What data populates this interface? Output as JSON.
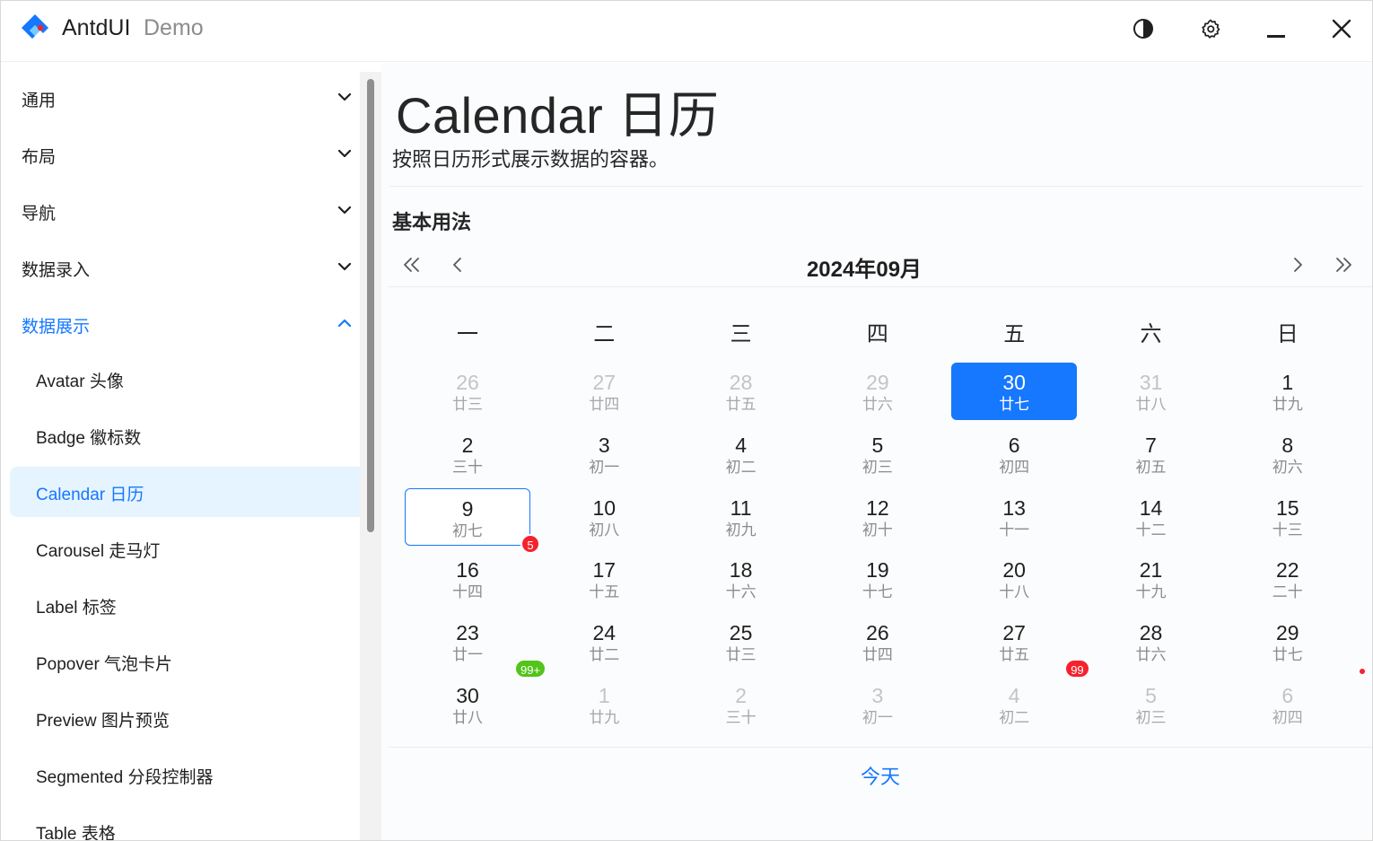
{
  "app": {
    "title": "AntdUI",
    "subtitle": "Demo"
  },
  "titlebar": {
    "icons": [
      "theme-toggle-icon",
      "settings-gear-icon",
      "minimize-icon",
      "close-icon"
    ]
  },
  "sidebar": {
    "groups": [
      {
        "label": "通用",
        "expanded": false
      },
      {
        "label": "布局",
        "expanded": false
      },
      {
        "label": "导航",
        "expanded": false
      },
      {
        "label": "数据录入",
        "expanded": false
      },
      {
        "label": "数据展示",
        "expanded": true
      }
    ],
    "items": [
      {
        "label": "Avatar 头像"
      },
      {
        "label": "Badge 徽标数"
      },
      {
        "label": "Calendar 日历",
        "active": true
      },
      {
        "label": "Carousel 走马灯"
      },
      {
        "label": "Label 标签"
      },
      {
        "label": "Popover 气泡卡片"
      },
      {
        "label": "Preview 图片预览"
      },
      {
        "label": "Segmented 分段控制器"
      },
      {
        "label": "Table 表格"
      }
    ]
  },
  "main": {
    "title": "Calendar 日历",
    "description": "按照日历形式展示数据的容器。",
    "section": "基本用法",
    "calendar": {
      "month_label": "2024年09月",
      "weekdays": [
        "一",
        "二",
        "三",
        "四",
        "五",
        "六",
        "日"
      ],
      "weeks": [
        [
          {
            "d": "26",
            "l": "廿三",
            "other": true
          },
          {
            "d": "27",
            "l": "廿四",
            "other": true
          },
          {
            "d": "28",
            "l": "廿五",
            "other": true
          },
          {
            "d": "29",
            "l": "廿六",
            "other": true
          },
          {
            "d": "30",
            "l": "廿七",
            "other": true,
            "selected": true
          },
          {
            "d": "31",
            "l": "廿八",
            "other": true
          },
          {
            "d": "1",
            "l": "廿九"
          }
        ],
        [
          {
            "d": "2",
            "l": "三十"
          },
          {
            "d": "3",
            "l": "初一"
          },
          {
            "d": "4",
            "l": "初二"
          },
          {
            "d": "5",
            "l": "初三"
          },
          {
            "d": "6",
            "l": "初四"
          },
          {
            "d": "7",
            "l": "初五"
          },
          {
            "d": "8",
            "l": "初六"
          }
        ],
        [
          {
            "d": "9",
            "l": "初七",
            "today": true
          },
          {
            "d": "10",
            "l": "初八"
          },
          {
            "d": "11",
            "l": "初九"
          },
          {
            "d": "12",
            "l": "初十"
          },
          {
            "d": "13",
            "l": "十一"
          },
          {
            "d": "14",
            "l": "十二"
          },
          {
            "d": "15",
            "l": "十三"
          }
        ],
        [
          {
            "d": "16",
            "l": "十四"
          },
          {
            "d": "17",
            "l": "十五"
          },
          {
            "d": "18",
            "l": "十六"
          },
          {
            "d": "19",
            "l": "十七"
          },
          {
            "d": "20",
            "l": "十八"
          },
          {
            "d": "21",
            "l": "十九"
          },
          {
            "d": "22",
            "l": "二十"
          }
        ],
        [
          {
            "d": "23",
            "l": "廿一"
          },
          {
            "d": "24",
            "l": "廿二"
          },
          {
            "d": "25",
            "l": "廿三"
          },
          {
            "d": "26",
            "l": "廿四"
          },
          {
            "d": "27",
            "l": "廿五"
          },
          {
            "d": "28",
            "l": "廿六"
          },
          {
            "d": "29",
            "l": "廿七"
          }
        ],
        [
          {
            "d": "30",
            "l": "廿八"
          },
          {
            "d": "1",
            "l": "廿九",
            "other": true
          },
          {
            "d": "2",
            "l": "三十",
            "other": true
          },
          {
            "d": "3",
            "l": "初一",
            "other": true
          },
          {
            "d": "4",
            "l": "初二",
            "other": true
          },
          {
            "d": "5",
            "l": "初三",
            "other": true
          },
          {
            "d": "6",
            "l": "初四",
            "other": true
          }
        ]
      ],
      "badges": [
        {
          "week": 2,
          "day": 0,
          "text": "5",
          "color": "#f5222d"
        },
        {
          "week": 4,
          "day": 0,
          "text": "99+",
          "color": "#52c41a"
        },
        {
          "week": 4,
          "day": 4,
          "text": "99",
          "color": "#f5222d"
        },
        {
          "week": 4,
          "day": 6,
          "text": "",
          "dot": true,
          "color": "#f5222d"
        }
      ],
      "today_label": "今天"
    }
  },
  "colors": {
    "accent": "#1677ff",
    "accent_light": "#e6f4ff",
    "badge_red": "#f5222d",
    "badge_green": "#52c41a"
  }
}
